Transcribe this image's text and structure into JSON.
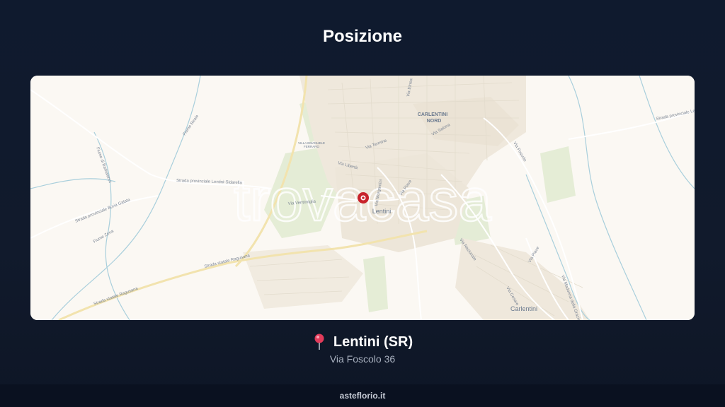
{
  "title": "Posizione",
  "map": {
    "watermark": "trovacasa",
    "marker_label": "Lentini",
    "places": {
      "carlentini_nord_line1": "CARLENTINI",
      "carlentini_nord_line2": "NORD",
      "carlentini": "Carlentini",
      "villa_line1": "VILLA EMANUELE",
      "villa_line2": "FERRARO"
    },
    "roads": {
      "via_ventimiglia": "Via Ventimiglia",
      "via_morgantini": "Via Morgantini",
      "via_nazionale": "Via Nazionale",
      "via_piave_top": "Via Piave",
      "via_piave_bottom": "Via Piave",
      "via_etnea": "Via Etnea",
      "via_salona": "Via Salona",
      "via_termine": "Via Termine",
      "via_liberta": "Via Libertà",
      "via_cesare": "Via Cesare",
      "via_foscolo_road": "Via Foscolo",
      "strada_statale_ragusana": "Strada statale Ragusana",
      "strada_ragusana": "Strada statale Ragusana",
      "strada_prov_lentini": "Strada provinciale Lentini-Sidarella",
      "strada_prov_boria": "Strada provinciale Boria Galata",
      "strada_prov_right": "Strada provinciale Lentini",
      "fiume_reale": "Fiume Reale",
      "fiume_zena": "Fiume Zena",
      "fiume_barbaianni": "Fiume di Barbaianni",
      "via_madonna": "Via Madonna della Grazie"
    },
    "colors": {
      "land": "#fbf8f3",
      "urban": "#efe9df",
      "green": "#dfe8cf",
      "road_main": "#f4e6b5",
      "water": "#9cc9d9",
      "marker": "#c8232c"
    }
  },
  "location": {
    "icon": "map-pin-icon",
    "city": "Lentini (SR)",
    "address": "Via Foscolo 36"
  },
  "footer": {
    "site": "asteflorio.it"
  }
}
